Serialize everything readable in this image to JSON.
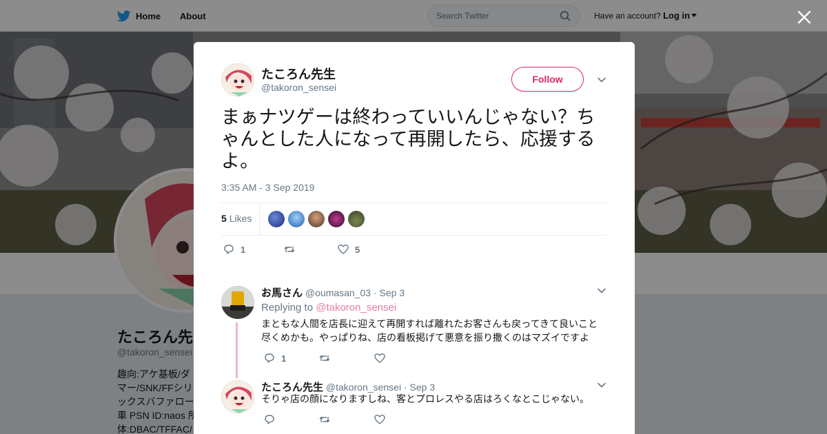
{
  "topbar": {
    "home_label": "Home",
    "about_label": "About",
    "search_placeholder": "Search Twitter",
    "account_prompt": "Have an account?",
    "login_label": "Log in"
  },
  "profile": {
    "name": "たころん先生",
    "handle": "@takoron_sensei",
    "bio_lines": [
      "趣向:アケ基板/ダ",
      "マー/SNK/FFシリ",
      "ックスバファロー",
      "車 PSN ID:naos 所",
      "体:DBAC/TFFAC/"
    ]
  },
  "tweet": {
    "author_name": "たころん先生",
    "author_handle": "@takoron_sensei",
    "follow_label": "Follow",
    "text": "まぁナツゲーは終わっていいんじゃない？ちゃんとした人になって再開したら、応援するよ。",
    "timestamp": "3:35 AM - 3 Sep 2019",
    "likes_count": "5",
    "likes_label": "Likes",
    "reply_count": "1",
    "like_count": "5"
  },
  "replies": [
    {
      "name": "お馬さん",
      "handle": "@oumasan_03",
      "date": "· Sep 3",
      "replying_prefix": "Replying to",
      "replying_to": "@takoron_sensei",
      "text_lines": [
        "まともな人間を店長に迎えて再開すれば離れたお客さんも戻ってきて良いこと",
        "尽くめかも。やっぱりね、店の看板掲げて悪意を振り撒くのはマズイですよ"
      ],
      "reply_count": "1"
    },
    {
      "name": "たころん先生",
      "handle": "@takoron_sensei",
      "date": "· Sep 3",
      "text": "そりゃ店の顔になりますしね、客とプロレスやる店はろくなとこじゃない。"
    }
  ],
  "colors": {
    "accent": "#e0245e",
    "twitter_blue": "#1da1f2",
    "secondary_text": "#657786"
  }
}
